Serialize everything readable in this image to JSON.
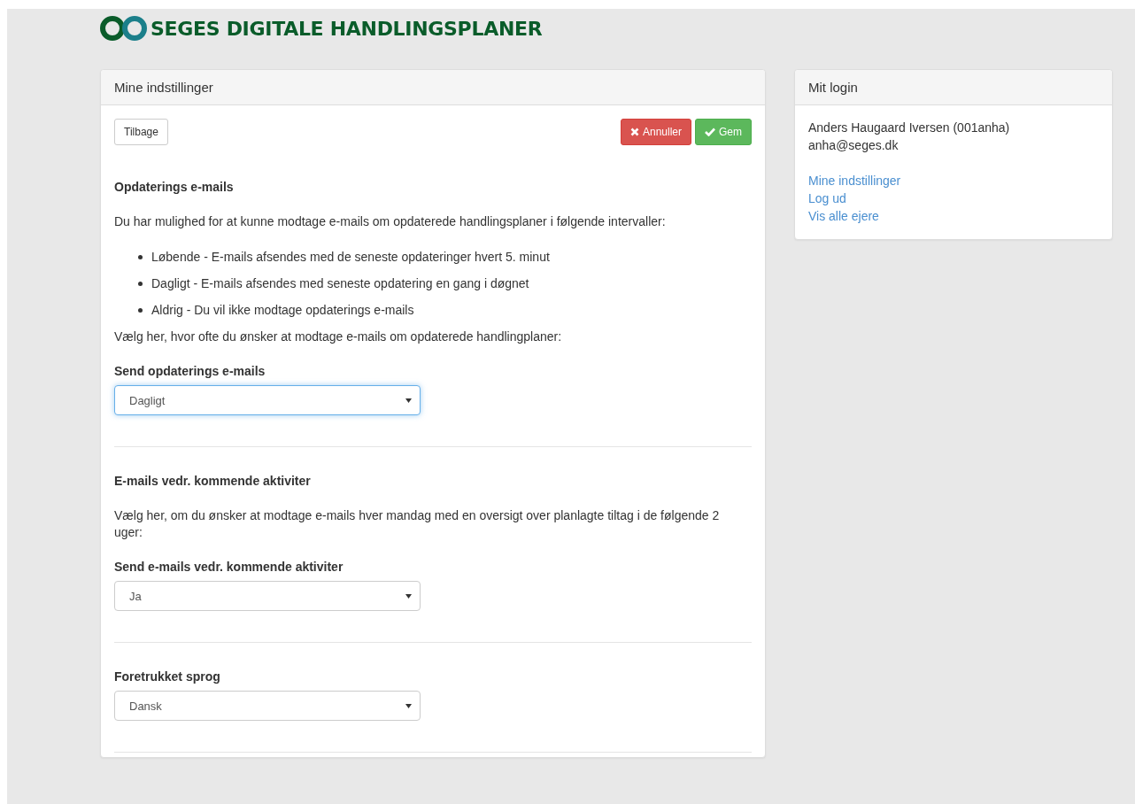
{
  "brand": {
    "title": "SEGES DIGITALE HANDLINGSPLANER"
  },
  "settings": {
    "title": "Mine indstillinger",
    "buttons": [
      {
        "kind": "back",
        "label": "Tilbage"
      },
      {
        "kind": "cancel",
        "label": "Annuller"
      },
      {
        "kind": "save",
        "label": "Gem"
      }
    ],
    "sections": [
      {
        "heading": "Opdaterings e-mails",
        "intro": "Du har mulighed for at kunne modtage e-mails om opdaterede handlingsplaner i følgende intervaller:",
        "bullets": [
          "Løbende - E-mails afsendes med de seneste opdateringer hvert 5. minut",
          "Dagligt - E-mails afsendes med seneste opdatering en gang i døgnet",
          "Aldrig - Du vil ikke modtage opdaterings e-mails"
        ],
        "prompt": "Vælg her, hvor ofte du ønsker at modtage e-mails om opdaterede handlingplaner:",
        "field": {
          "label": "Send opdaterings e-mails",
          "value": "Dagligt",
          "focused": true
        }
      },
      {
        "heading": "E-mails vedr. kommende aktiviter",
        "intro": "Vælg her, om du ønsker at modtage e-mails hver mandag med en oversigt over planlagte tiltag i de følgende 2 uger:",
        "field": {
          "label": "Send e-mails vedr. kommende aktiviter",
          "value": "Ja",
          "focused": false
        }
      },
      {
        "field": {
          "label": "Foretrukket sprog",
          "value": "Dansk",
          "focused": false
        }
      }
    ]
  },
  "login": {
    "title": "Mit login",
    "name": "Anders Haugaard Iversen (001anha)",
    "email": "anha@seges.dk",
    "links": [
      "Mine indstillinger",
      "Log ud",
      "Vis alle ejere"
    ]
  }
}
